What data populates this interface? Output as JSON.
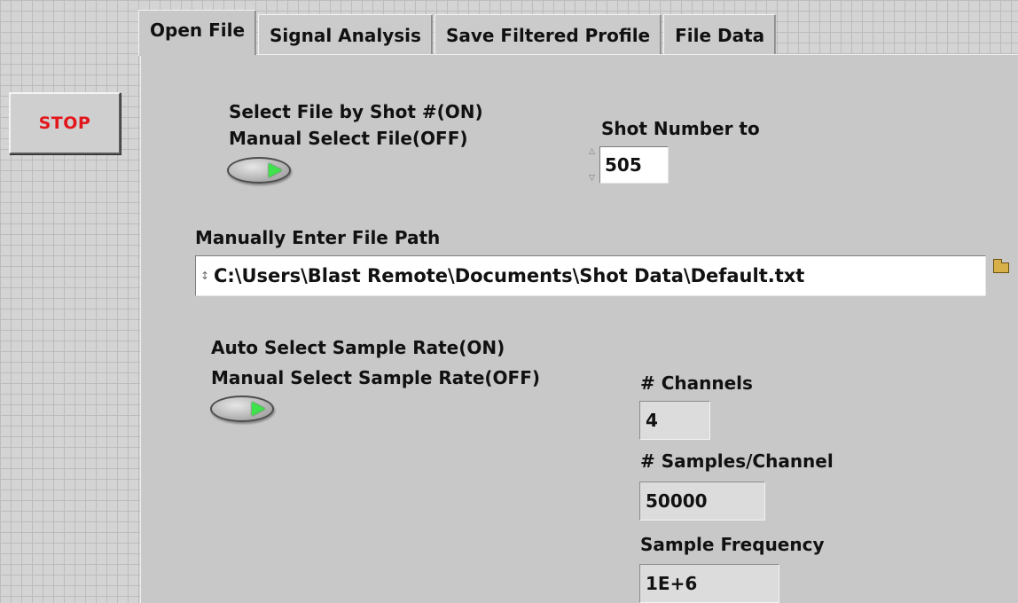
{
  "app": {
    "stop_label": "STOP"
  },
  "tabs": [
    {
      "label": "Open File",
      "active": true
    },
    {
      "label": "Signal Analysis",
      "active": false
    },
    {
      "label": "Save Filtered Profile",
      "active": false
    },
    {
      "label": "File Data",
      "active": false
    }
  ],
  "open_file": {
    "select_mode": {
      "label_on": "Select File by Shot #(ON)",
      "label_off": "Manual Select File(OFF)",
      "state": "ON"
    },
    "shot_number": {
      "label": "Shot Number to",
      "value": "505"
    },
    "file_path": {
      "label": "Manually Enter File Path",
      "value": "C:\\Users\\Blast Remote\\Documents\\Shot Data\\Default.txt"
    },
    "sample_rate_mode": {
      "label_on": "Auto Select Sample Rate(ON)",
      "label_off": "Manual Select Sample Rate(OFF)",
      "state": "ON"
    },
    "channels": {
      "label": "# Channels",
      "value": "4"
    },
    "samples_per_channel": {
      "label": "# Samples/Channel",
      "value": "50000"
    },
    "sample_frequency": {
      "label": "Sample Frequency",
      "value": "1E+6"
    }
  },
  "icons": {
    "spinner_up": "increment-arrow-icon",
    "spinner_down": "decrement-arrow-icon",
    "path": "path-icon",
    "browse": "folder-icon",
    "toggle_led": "led-indicator-icon"
  },
  "colors": {
    "stop_text": "#e3161c",
    "led_on": "#3ee24a",
    "panel_bg": "#c8c8c8",
    "grid_bg": "#d4d4d4"
  }
}
